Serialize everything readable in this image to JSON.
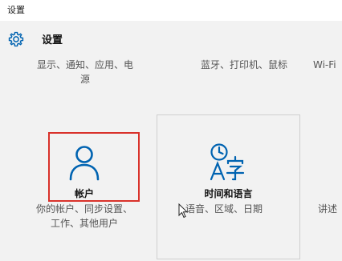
{
  "window": {
    "title": "设置"
  },
  "header": {
    "icon": "gear-icon",
    "title": "设置",
    "accent": "#0063b1"
  },
  "categories": {
    "system": {
      "desc_line1": "显示、通知、应用、电",
      "desc_line2": "源"
    },
    "devices": {
      "desc_line1": "蓝牙、打印机、鼠标"
    },
    "network": {
      "desc_line1": "Wi-Fi"
    },
    "accounts": {
      "label": "帐户",
      "icon": "person-icon",
      "desc_line1": "你的帐户、同步设置、",
      "desc_line2": "工作、其他用户",
      "highlight_color": "#d9322b"
    },
    "time_language": {
      "label": "时间和语言",
      "icon": "time-language-icon",
      "desc_line1": "语音、区域、日期"
    },
    "ease_of_access": {
      "desc_line1": "讲述"
    }
  }
}
